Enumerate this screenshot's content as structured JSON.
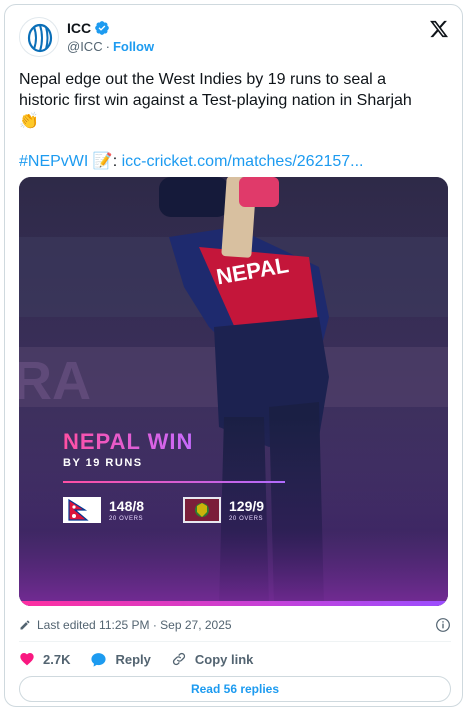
{
  "account": {
    "name": "ICC",
    "handle": "@ICC",
    "separator": "·",
    "follow_label": "Follow"
  },
  "tweet": {
    "line1": "Nepal edge out the West Indies by 19 runs to seal a",
    "line2": "historic first win against a Test-playing nation in Sharjah",
    "clap_emoji": "👏",
    "hashtag": "#NEPvWI",
    "memo_emoji": "📝",
    "colon": ":",
    "link_text": "icc-cricket.com/matches/262157..."
  },
  "media": {
    "headline": "NEPAL WIN",
    "subline": "BY 19 RUNS",
    "teams": [
      {
        "flag_icon": "nepal-flag-icon",
        "score": "148/8",
        "overs": "20 OVERS"
      },
      {
        "flag_icon": "west-indies-flag-icon",
        "score": "129/9",
        "overs": "20 OVERS"
      }
    ],
    "colors": {
      "accent_pink": "#ff4fa3",
      "accent_purple": "#b16bff",
      "jersey_red": "#c4163a",
      "jersey_navy": "#1e2a6e"
    }
  },
  "meta": {
    "edited_text": "Last edited 11:25 PM · Sep 27, 2025"
  },
  "actions": {
    "likes": "2.7K",
    "reply_label": "Reply",
    "copy_label": "Copy link"
  },
  "replies_button": "Read 56 replies",
  "colors": {
    "link": "#1d9bf0",
    "muted": "#536471",
    "like": "#f91880"
  }
}
